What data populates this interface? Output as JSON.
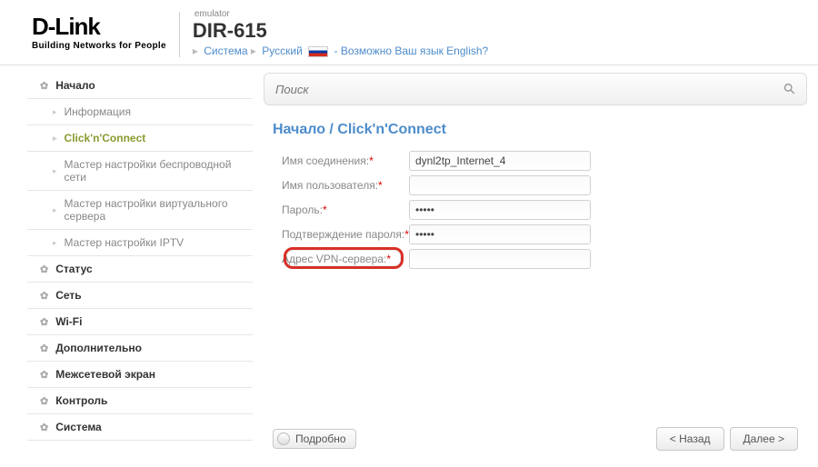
{
  "header": {
    "logo": "D-Link",
    "logo_sub": "Building Networks for People",
    "emulator": "emulator",
    "model": "DIR-615",
    "crumb_system": "Система",
    "crumb_lang": "Русский",
    "lang_hint": "- Возможно Ваш язык English?"
  },
  "search": {
    "placeholder": "Поиск"
  },
  "sidebar": {
    "start": "Начало",
    "info": "Информация",
    "click": "Click'n'Connect",
    "wifi_wizard": "Мастер настройки беспроводной сети",
    "vs_wizard": "Мастер настройки виртуального сервера",
    "iptv_wizard": "Мастер настройки IPTV",
    "status": "Статус",
    "net": "Сеть",
    "wifi": "Wi-Fi",
    "extra": "Дополнительно",
    "firewall": "Межсетевой экран",
    "control": "Контроль",
    "system": "Система"
  },
  "page": {
    "title": "Начало /  Click'n'Connect"
  },
  "form": {
    "conn_name": {
      "label": "Имя соединения:",
      "value": "dynl2tp_Internet_4"
    },
    "username": {
      "label": "Имя пользователя:",
      "value": ""
    },
    "password": {
      "label": "Пароль:",
      "value": "•••••"
    },
    "password2": {
      "label": "Подтверждение пароля:",
      "value": "•••••"
    },
    "vpn": {
      "label": "Адрес VPN-сервера:",
      "value": ""
    }
  },
  "buttons": {
    "detail": "Подробно",
    "back": "< Назад",
    "next": "Далее >"
  }
}
